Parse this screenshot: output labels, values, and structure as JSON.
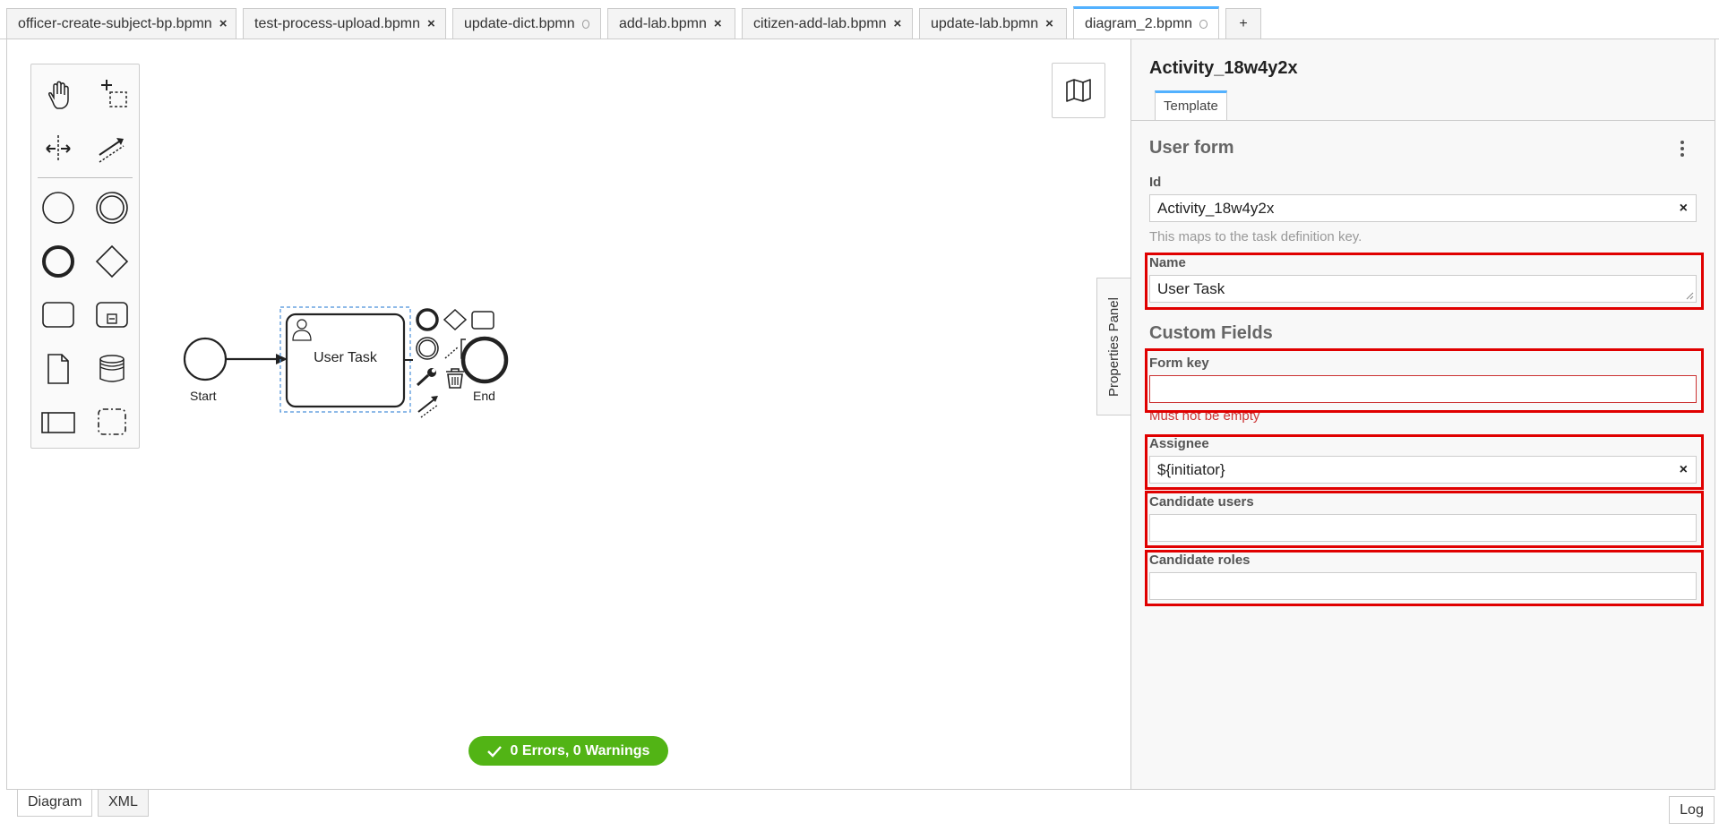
{
  "tabs": [
    {
      "label": "officer-create-subject-bp.bpmn",
      "state": "close"
    },
    {
      "label": "test-process-upload.bpmn",
      "state": "close"
    },
    {
      "label": "update-dict.bpmn",
      "state": "dot"
    },
    {
      "label": "add-lab.bpmn",
      "state": "close"
    },
    {
      "label": "citizen-add-lab.bpmn",
      "state": "close"
    },
    {
      "label": "update-lab.bpmn",
      "state": "close"
    },
    {
      "label": "diagram_2.bpmn",
      "state": "dot",
      "active": true
    }
  ],
  "tab_close_glyph": "×",
  "add_tab_label": "+",
  "diagram": {
    "start_label": "Start",
    "task_label": "User Task",
    "end_label": "End"
  },
  "status": {
    "text": "0 Errors, 0 Warnings",
    "color": "#52b415"
  },
  "properties_panel_toggle": "Properties Panel",
  "panel": {
    "title": "Activity_18w4y2x",
    "tab": "Template",
    "group_title": "User form",
    "id_label": "Id",
    "id_value": "Activity_18w4y2x",
    "id_hint": "This maps to the task definition key.",
    "name_label": "Name",
    "name_value": "User Task",
    "custom_fields_title": "Custom Fields",
    "form_key_label": "Form key",
    "form_key_value": "",
    "form_key_error": "Must not be empty",
    "assignee_label": "Assignee",
    "assignee_value": "${initiator}",
    "candidate_users_label": "Candidate users",
    "candidate_users_value": "",
    "candidate_roles_label": "Candidate roles",
    "candidate_roles_value": "",
    "clear_glyph": "×"
  },
  "bottom_tabs": [
    "Diagram",
    "XML"
  ],
  "log_label": "Log",
  "colors": {
    "accent": "#52b1ff",
    "error": "#cc3333",
    "highlight": "#e00000",
    "success": "#52b415"
  }
}
